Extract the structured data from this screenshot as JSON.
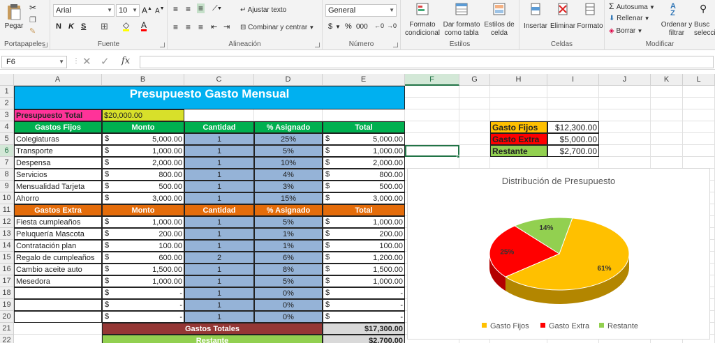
{
  "ribbon": {
    "clipboard": {
      "paste": "Pegar",
      "label": "Portapapeles"
    },
    "font": {
      "name": "Arial",
      "size": "10",
      "bold": "N",
      "italic": "K",
      "underline": "S",
      "label": "Fuente"
    },
    "alignment": {
      "wrap": "Ajustar texto",
      "merge": "Combinar y centrar",
      "label": "Alineación"
    },
    "number": {
      "format": "General",
      "currency": "$",
      "percent": "%",
      "thousands": "000",
      "label": "Número"
    },
    "styles": {
      "conditional": [
        "Formato",
        "condicional"
      ],
      "table": [
        "Dar formato",
        "como tabla"
      ],
      "cell": [
        "Estilos de",
        "celda"
      ],
      "label": "Estilos"
    },
    "cells": {
      "insert": "Insertar",
      "delete": "Eliminar",
      "format": "Formato",
      "label": "Celdas"
    },
    "editing": {
      "autosum": "Autosuma",
      "fill": "Rellenar",
      "clear": "Borrar",
      "sort": [
        "Ordenar y",
        "filtrar"
      ],
      "find": [
        "Busc",
        "selecci"
      ],
      "label": "Modificar"
    }
  },
  "formula_bar": {
    "name_box": "F6",
    "fx": "fx",
    "formula": ""
  },
  "columns": [
    "A",
    "B",
    "C",
    "D",
    "E",
    "F",
    "G",
    "H",
    "I",
    "J",
    "K",
    "L"
  ],
  "rows": [
    "1",
    "2",
    "3",
    "4",
    "5",
    "6",
    "7",
    "8",
    "9",
    "10",
    "11",
    "12",
    "13",
    "14",
    "15",
    "16",
    "17",
    "18",
    "19",
    "20",
    "21",
    "22"
  ],
  "sheet": {
    "title": "Presupuesto Gasto Mensual",
    "budget_label": "Presupuesto Total",
    "budget_value": "$20,000.00",
    "fixed_headers": [
      "Gastos Fijos",
      "Monto",
      "Cantidad",
      "% Asignado",
      "Total"
    ],
    "fixed_rows": [
      [
        "Colegiaturas",
        "$",
        "5,000.00",
        "1",
        "25%",
        "$",
        "5,000.00"
      ],
      [
        "Transporte",
        "$",
        "1,000.00",
        "1",
        "5%",
        "$",
        "1,000.00"
      ],
      [
        "Despensa",
        "$",
        "2,000.00",
        "1",
        "10%",
        "$",
        "2,000.00"
      ],
      [
        "Servicios",
        "$",
        "800.00",
        "1",
        "4%",
        "$",
        "800.00"
      ],
      [
        "Mensualidad Tarjeta",
        "$",
        "500.00",
        "1",
        "3%",
        "$",
        "500.00"
      ],
      [
        "Ahorro",
        "$",
        "3,000.00",
        "1",
        "15%",
        "$",
        "3,000.00"
      ]
    ],
    "extra_headers": [
      "Gastos Extra",
      "Monto",
      "Cantidad",
      "% Asignado",
      "Total"
    ],
    "extra_rows": [
      [
        "Fiesta cumpleaños",
        "$",
        "1,000.00",
        "1",
        "5%",
        "$",
        "1,000.00"
      ],
      [
        "Peluquería Mascota",
        "$",
        "200.00",
        "1",
        "1%",
        "$",
        "200.00"
      ],
      [
        "Contratación plan",
        "$",
        "100.00",
        "1",
        "1%",
        "$",
        "100.00"
      ],
      [
        "Regalo de cumpleaños",
        "$",
        "600.00",
        "2",
        "6%",
        "$",
        "1,200.00"
      ],
      [
        "Cambio aceite auto",
        "$",
        "1,500.00",
        "1",
        "8%",
        "$",
        "1,500.00"
      ],
      [
        "Mesedora",
        "$",
        "1,000.00",
        "1",
        "5%",
        "$",
        "1,000.00"
      ],
      [
        "",
        "$",
        "-",
        "1",
        "0%",
        "$",
        "-"
      ],
      [
        "",
        "$",
        "-",
        "1",
        "0%",
        "$",
        "-"
      ],
      [
        "",
        "$",
        "-",
        "1",
        "0%",
        "$",
        "-"
      ]
    ],
    "total_label": "Gastos Totales",
    "total_value": "$17,300.00",
    "remaining_label": "Restante",
    "remaining_value": "$2,700.00"
  },
  "summary": [
    {
      "label": "Gasto Fijos",
      "value": "$12,300.00",
      "color": "#ffc000"
    },
    {
      "label": "Gasto Extra",
      "value": "$5,000.00",
      "color": "#ff0000"
    },
    {
      "label": "Restante",
      "value": "$2,700.00",
      "color": "#92d050"
    }
  ],
  "colors": {
    "title_bg": "#00b0f0",
    "fixed_header": "#00b050",
    "extra_header": "#e46c0a",
    "blue_cols": "#95b3d7",
    "budget_label": "#ff3399",
    "budget_value": "#d8e02a",
    "total_bar": "#953735",
    "remaining_bar": "#92d050",
    "total_cell": "#d9d9d9"
  },
  "chart_data": {
    "type": "pie",
    "title": "Distribución de Presupuesto",
    "categories": [
      "Gasto Fijos",
      "Gasto Extra",
      "Restante"
    ],
    "values": [
      61,
      25,
      14
    ],
    "labels": [
      "61%",
      "25%",
      "14%"
    ],
    "colors": [
      "#ffc000",
      "#ff0000",
      "#92d050"
    ],
    "legend": "bottom"
  }
}
